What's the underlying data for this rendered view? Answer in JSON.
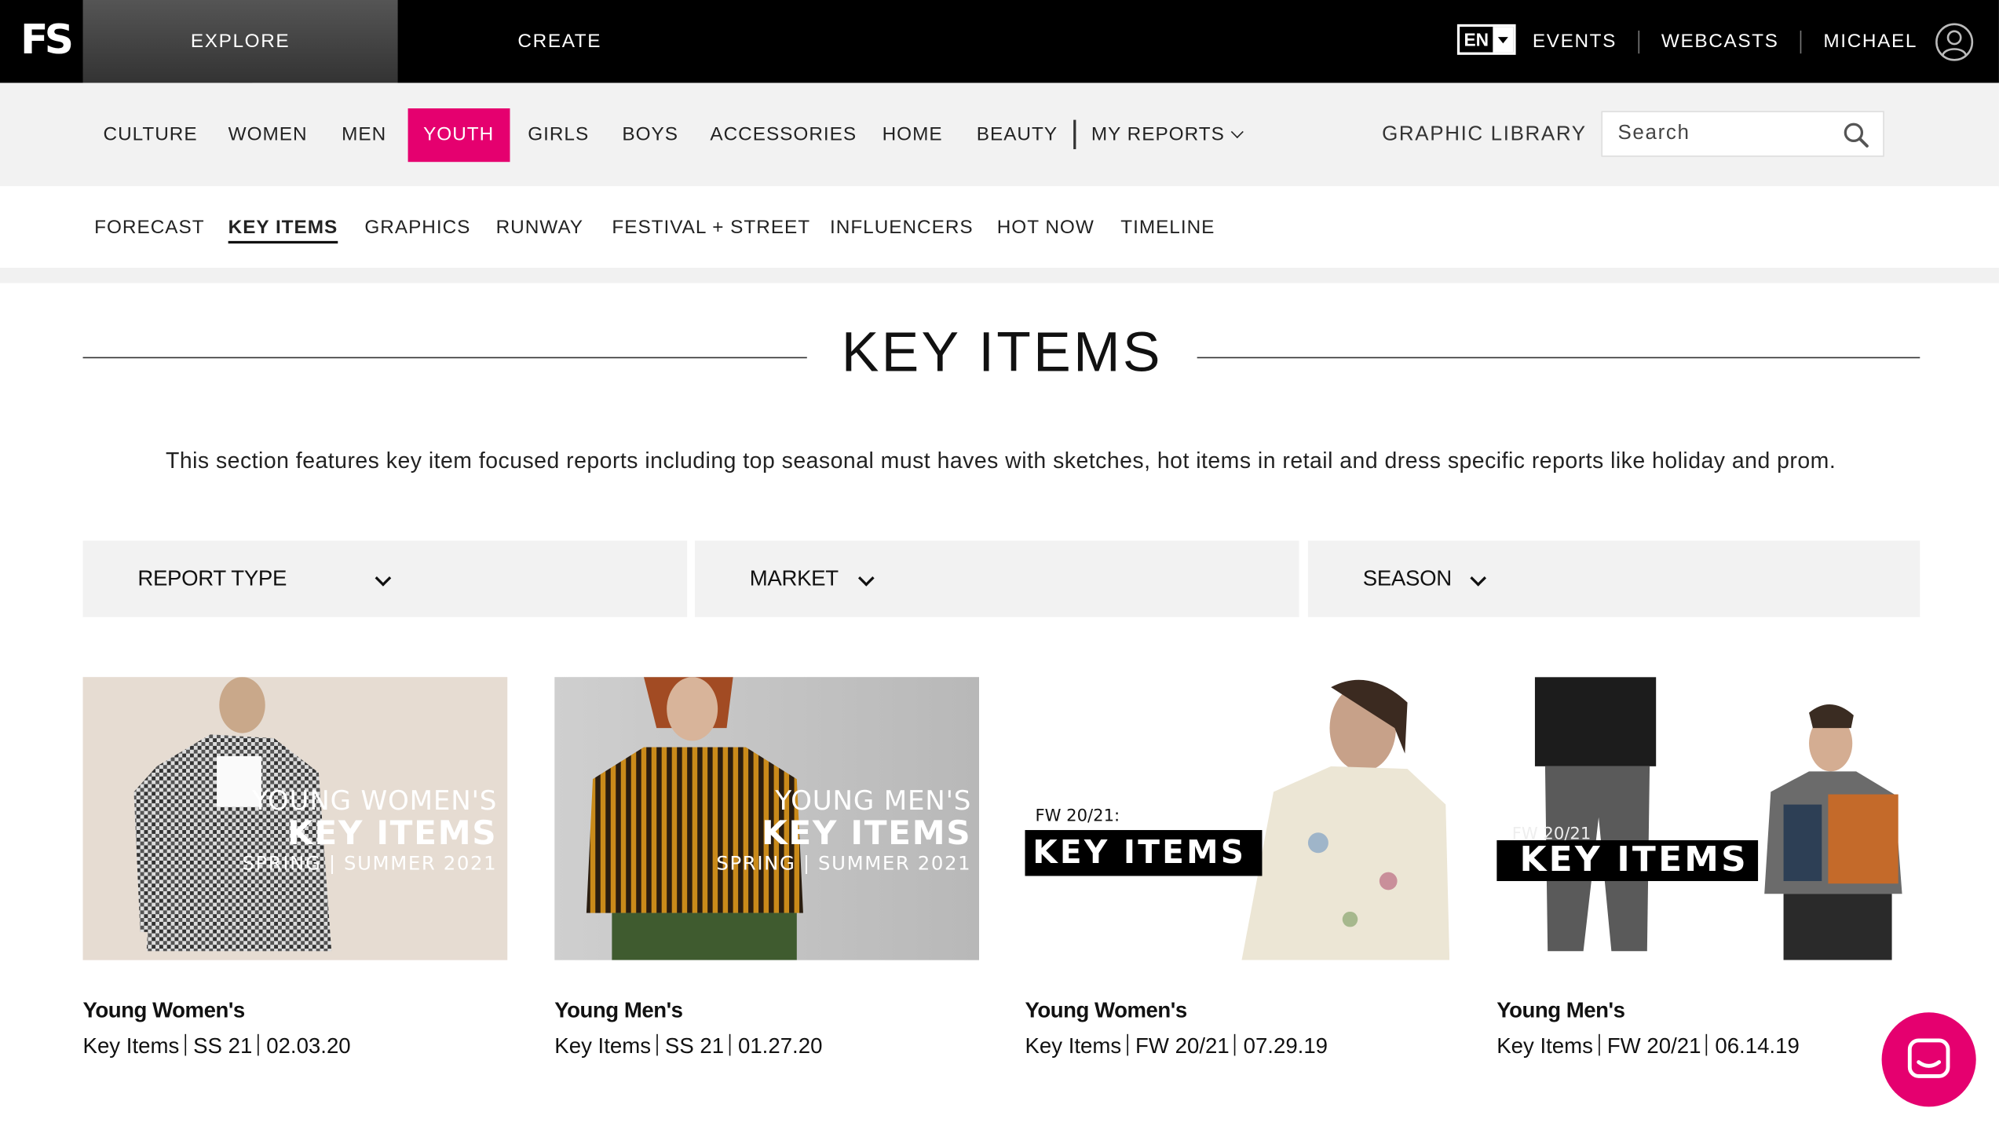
{
  "topbar": {
    "logo": "FS",
    "tabs": [
      {
        "label": "EXPLORE"
      },
      {
        "label": "CREATE"
      }
    ],
    "language": "EN",
    "links": [
      {
        "label": "EVENTS"
      },
      {
        "label": "WEBCASTS"
      },
      {
        "label": "MICHAEL"
      }
    ]
  },
  "main_nav": {
    "items": [
      {
        "label": "CULTURE"
      },
      {
        "label": "WOMEN"
      },
      {
        "label": "MEN"
      },
      {
        "label": "YOUTH"
      },
      {
        "label": "GIRLS"
      },
      {
        "label": "BOYS"
      },
      {
        "label": "ACCESSORIES"
      },
      {
        "label": "HOME"
      },
      {
        "label": "BEAUTY"
      }
    ],
    "my_reports": "MY REPORTS",
    "graphic_library": "GRAPHIC LIBRARY",
    "search_placeholder": "Search",
    "active_color": "#e5006f"
  },
  "sub_nav": {
    "items": [
      {
        "label": "FORECAST"
      },
      {
        "label": "KEY ITEMS"
      },
      {
        "label": "GRAPHICS"
      },
      {
        "label": "RUNWAY"
      },
      {
        "label": "FESTIVAL + STREET"
      },
      {
        "label": "INFLUENCERS"
      },
      {
        "label": "HOT NOW"
      },
      {
        "label": "TIMELINE"
      }
    ]
  },
  "page": {
    "title": "KEY ITEMS",
    "intro": "This section features key item focused reports including top seasonal must haves with sketches, hot items in retail and dress specific reports like holiday and prom."
  },
  "filters": [
    {
      "label": "REPORT TYPE"
    },
    {
      "label": "MARKET"
    },
    {
      "label": "SEASON"
    }
  ],
  "cards": [
    {
      "title": "Young Women's",
      "type": "Key Items",
      "season": "SS 21",
      "date": "02.03.20",
      "image_text": {
        "l1": "YOUNG WOMEN'S",
        "l2": "KEY ITEMS",
        "l3": "SPRING | SUMMER 2021"
      }
    },
    {
      "title": "Young Men's",
      "type": "Key Items",
      "season": "SS 21",
      "date": "01.27.20",
      "image_text": {
        "l1": "YOUNG MEN'S",
        "l2": "KEY ITEMS",
        "l3": "SPRING | SUMMER 2021"
      }
    },
    {
      "title": "Young Women's",
      "type": "Key Items",
      "season": "FW 20/21",
      "date": "07.29.19",
      "image_text": {
        "l1": "FW 20/21:",
        "l2": "KEY ITEMS"
      }
    },
    {
      "title": "Young Men's",
      "type": "Key Items",
      "season": "FW 20/21",
      "date": "06.14.19",
      "image_text": {
        "l1": "FW 20/21",
        "l2": "KEY ITEMS"
      }
    }
  ]
}
